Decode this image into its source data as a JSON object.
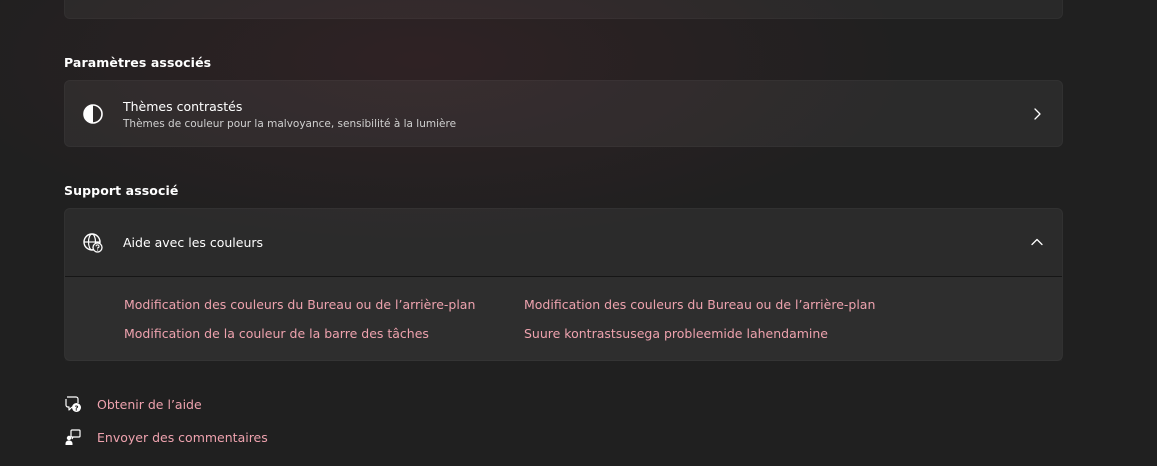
{
  "related_settings": {
    "heading": "Paramètres associés",
    "contrast_themes": {
      "title": "Thèmes contrastés",
      "subtitle": "Thèmes de couleur pour la malvoyance, sensibilité à la lumière",
      "icon": "contrast-icon"
    }
  },
  "related_support": {
    "heading": "Support associé",
    "help_colors": {
      "title": "Aide avec les couleurs",
      "icon": "globe-help-icon",
      "expanded": true
    },
    "links": [
      "Modification des couleurs du Bureau ou de l’arrière-plan",
      "Modification des couleurs du Bureau ou de l’arrière-plan",
      "Modification de la couleur de la barre des tâches",
      "Suure kontrastsusega probleemide lahendamine"
    ]
  },
  "footer": {
    "get_help": "Obtenir de l’aide",
    "send_feedback": "Envoyer des commentaires"
  },
  "colors": {
    "background": "#202020",
    "card": "#2b2b2b",
    "accent_link": "#eea2ae"
  }
}
